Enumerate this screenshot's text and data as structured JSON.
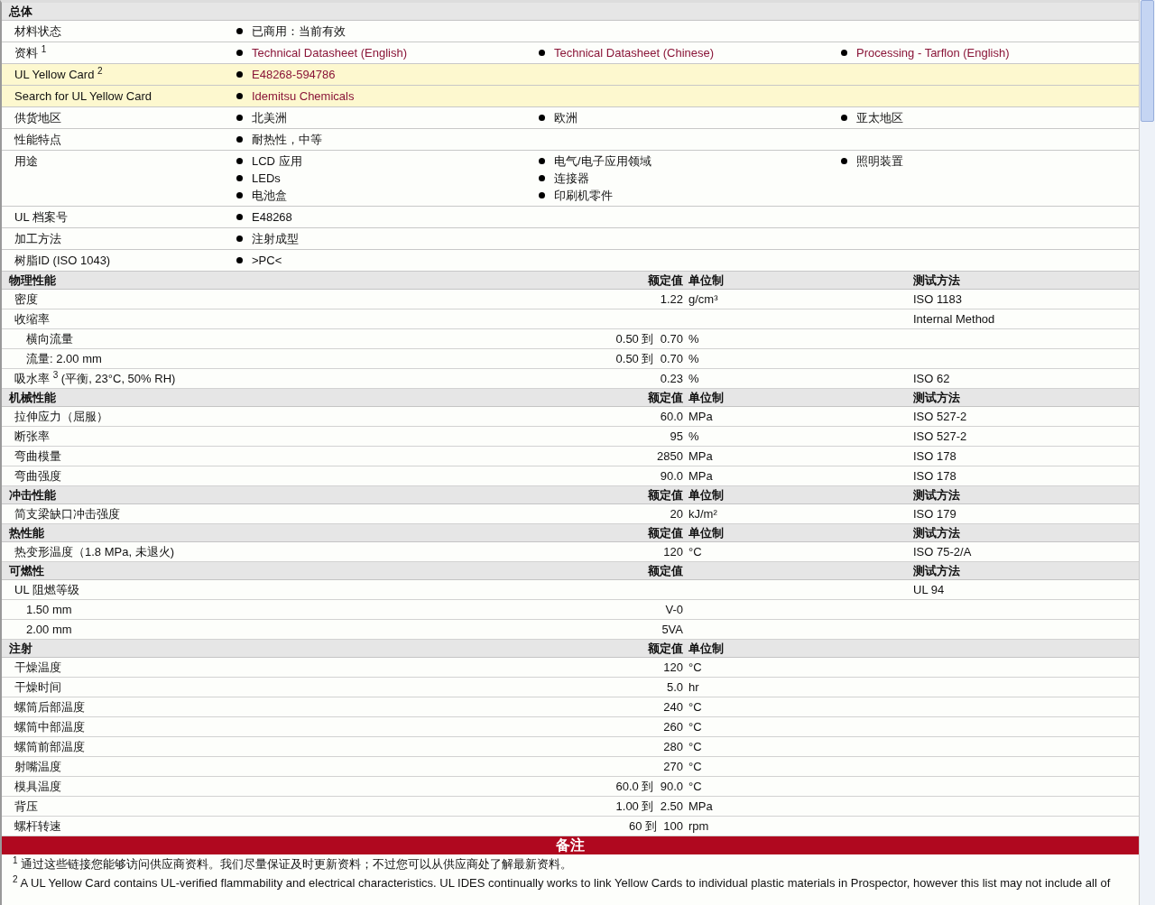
{
  "general": {
    "title": "总体",
    "rows": [
      {
        "label": "材料状态",
        "highlighted": false,
        "columns": [
          [
            {
              "text": "已商用：当前有效",
              "link": false
            }
          ]
        ]
      },
      {
        "label": "资料 $^{1}$",
        "highlighted": false,
        "columns": [
          [
            {
              "text": "Technical Datasheet (English)",
              "link": true
            }
          ],
          [
            {
              "text": "Technical Datasheet (Chinese)",
              "link": true
            }
          ],
          [
            {
              "text": "Processing - Tarflon (English)",
              "link": true
            }
          ]
        ]
      },
      {
        "label": "UL Yellow Card $^{2}$",
        "highlighted": true,
        "columns": [
          [
            {
              "text": "E48268-594786",
              "link": true
            }
          ]
        ]
      },
      {
        "label": "Search for UL Yellow Card",
        "highlighted": true,
        "columns": [
          [
            {
              "text": "Idemitsu Chemicals",
              "link": true
            }
          ]
        ]
      },
      {
        "label": "供货地区",
        "highlighted": false,
        "columns": [
          [
            {
              "text": "北美洲",
              "link": false
            }
          ],
          [
            {
              "text": "欧洲",
              "link": false
            }
          ],
          [
            {
              "text": "亚太地区",
              "link": false
            }
          ]
        ]
      },
      {
        "label": "性能特点",
        "highlighted": false,
        "columns": [
          [
            {
              "text": "耐热性，中等",
              "link": false
            }
          ]
        ]
      },
      {
        "label": "用途",
        "highlighted": false,
        "columns": [
          [
            {
              "text": "LCD 应用",
              "link": false
            },
            {
              "text": "LEDs",
              "link": false
            },
            {
              "text": "电池盒",
              "link": false
            }
          ],
          [
            {
              "text": "电气/电子应用领域",
              "link": false
            },
            {
              "text": "连接器",
              "link": false
            },
            {
              "text": "印刷机零件",
              "link": false
            }
          ],
          [
            {
              "text": "照明装置",
              "link": false
            }
          ]
        ]
      },
      {
        "label": "UL 档案号",
        "highlighted": false,
        "columns": [
          [
            {
              "text": "E48268",
              "link": false
            }
          ]
        ]
      },
      {
        "label": "加工方法",
        "highlighted": false,
        "columns": [
          [
            {
              "text": "注射成型",
              "link": false
            }
          ]
        ]
      },
      {
        "label": "树脂ID (ISO 1043)",
        "highlighted": false,
        "columns": [
          [
            {
              "text": ">PC<",
              "link": false
            }
          ]
        ]
      }
    ]
  },
  "sections": [
    {
      "title": "物理性能",
      "value_heading": "额定值",
      "unit_heading": "单位制",
      "method_heading": "测试方法",
      "rows": [
        {
          "label": "密度",
          "value": "1.22",
          "unit": "g/cm³",
          "method": "ISO 1183"
        },
        {
          "label": "收缩率",
          "method": "Internal Method",
          "children": [
            {
              "label": "横向流量",
              "value": "0.50 到  0.70",
              "unit": "%"
            },
            {
              "label": "流量: 2.00 mm",
              "value": "0.50 到  0.70",
              "unit": "%"
            }
          ]
        },
        {
          "label": "吸水率 $^{3}$ (平衡, 23°C, 50% RH)",
          "value": "0.23",
          "unit": "%",
          "method": "ISO 62"
        }
      ]
    },
    {
      "title": "机械性能",
      "value_heading": "额定值",
      "unit_heading": "单位制",
      "method_heading": "测试方法",
      "rows": [
        {
          "label": "拉伸应力（屈服）",
          "value": "60.0",
          "unit": "MPa",
          "method": "ISO 527-2"
        },
        {
          "label": "断张率",
          "value": "95",
          "unit": "%",
          "method": "ISO 527-2"
        },
        {
          "label": "弯曲模量",
          "value": "2850",
          "unit": "MPa",
          "method": "ISO 178"
        },
        {
          "label": "弯曲强度",
          "value": "90.0",
          "unit": "MPa",
          "method": "ISO 178"
        }
      ]
    },
    {
      "title": "冲击性能",
      "value_heading": "额定值",
      "unit_heading": "单位制",
      "method_heading": "测试方法",
      "rows": [
        {
          "label": "简支梁缺口冲击强度",
          "value": "20",
          "unit": "kJ/m²",
          "method": "ISO 179"
        }
      ]
    },
    {
      "title": "热性能",
      "value_heading": "额定值",
      "unit_heading": "单位制",
      "method_heading": "测试方法",
      "rows": [
        {
          "label": "热变形温度（1.8 MPa, 未退火)",
          "value": "120",
          "unit": "°C",
          "method": "ISO 75-2/A"
        }
      ]
    },
    {
      "title": "可燃性",
      "value_heading": "额定值",
      "method_heading": "测试方法",
      "rows": [
        {
          "label": "UL 阻燃等级",
          "method": "UL 94",
          "children": [
            {
              "label": "1.50 mm",
              "value": "V-0"
            },
            {
              "label": "2.00 mm",
              "value": "5VA"
            }
          ]
        }
      ]
    },
    {
      "title": "注射",
      "value_heading": "额定值",
      "unit_heading": "单位制",
      "rows": [
        {
          "label": "干燥温度",
          "value": "120",
          "unit": "°C"
        },
        {
          "label": "干燥时间",
          "value": "5.0",
          "unit": "hr"
        },
        {
          "label": "螺筒后部温度",
          "value": "240",
          "unit": "°C"
        },
        {
          "label": "螺筒中部温度",
          "value": "260",
          "unit": "°C"
        },
        {
          "label": "螺筒前部温度",
          "value": "280",
          "unit": "°C"
        },
        {
          "label": "射嘴温度",
          "value": "270",
          "unit": "°C"
        },
        {
          "label": "模具温度",
          "value": "60.0 到  90.0",
          "unit": "°C"
        },
        {
          "label": "背压",
          "value": "1.00 到  2.50",
          "unit": "MPa"
        },
        {
          "label": "螺杆转速",
          "value": "60 到  100",
          "unit": "rpm"
        }
      ]
    }
  ],
  "notes": {
    "title": "备注",
    "items": [
      "$^{1}$ 通过这些链接您能够访问供应商资料。我们尽量保证及时更新资料；不过您可以从供应商处了解最新资料。",
      "$^{2}$ A UL Yellow Card contains UL-verified flammability and electrical characteristics. UL IDES continually works to link Yellow Cards to individual plastic materials in Prospector, however this list may not include all of"
    ]
  }
}
